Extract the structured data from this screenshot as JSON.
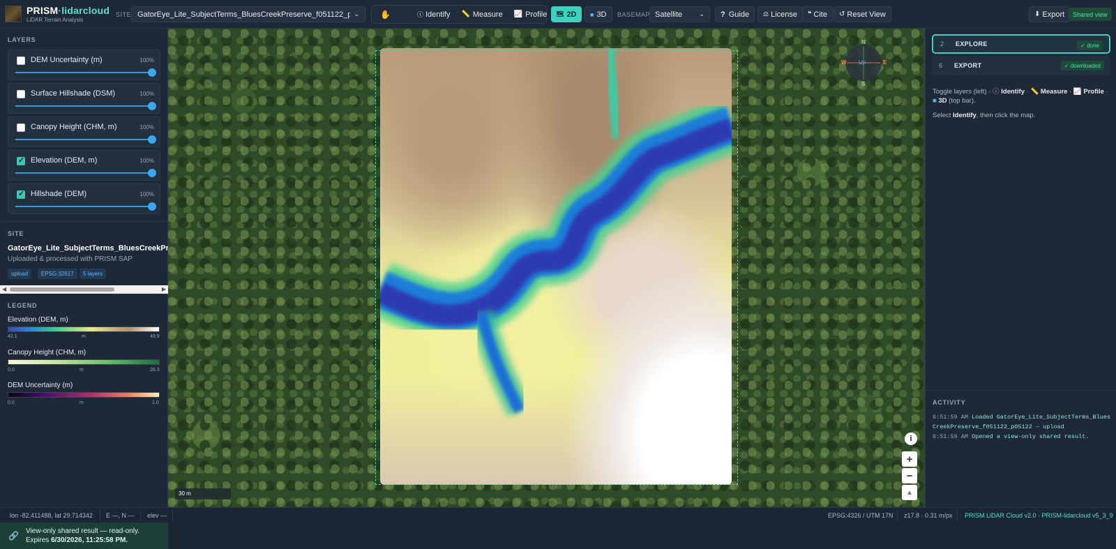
{
  "app": {
    "brand_main": "PRISM",
    "brand_accent": "·lidarcloud",
    "subtitle": "LiDAR Terrain Analysis"
  },
  "topbar": {
    "site_label": "SITE",
    "site_value": "GatorEye_Lite_SubjectTerms_BluesCreekPreserve_f051122_p05122",
    "tools": {
      "pan_icon": "hand-icon",
      "identify": "Identify",
      "measure": "Measure",
      "profile": "Profile"
    },
    "mode_2d": "2D",
    "mode_3d": "3D",
    "basemap_label": "BASEMAP",
    "basemap_value": "Satellite",
    "guide": "Guide",
    "license": "License",
    "cite": "Cite",
    "reset_view": "Reset View",
    "export": "Export",
    "shared_view": "Shared view"
  },
  "layers": {
    "title": "LAYERS",
    "items": [
      {
        "name": "DEM Uncertainty (m)",
        "opacity": "100%",
        "checked": false
      },
      {
        "name": "Surface Hillshade (DSM)",
        "opacity": "100%",
        "checked": false
      },
      {
        "name": "Canopy Height (CHM, m)",
        "opacity": "100%",
        "checked": false
      },
      {
        "name": "Elevation (DEM, m)",
        "opacity": "100%",
        "checked": true
      },
      {
        "name": "Hillshade (DEM)",
        "opacity": "100%",
        "checked": true
      }
    ]
  },
  "site": {
    "title": "SITE",
    "name": "GatorEye_Lite_SubjectTerms_BluesCreekPreserve_f051122_p05122",
    "desc": "Uploaded & processed with PRISM SAP",
    "chips": [
      "upload",
      "EPSG:32617",
      "5 layers"
    ]
  },
  "legend": {
    "title": "LEGEND",
    "items": [
      {
        "name": "Elevation (DEM, m)",
        "min": "42.1",
        "unit": "m",
        "max": "49.9"
      },
      {
        "name": "Canopy Height (CHM, m)",
        "min": "0.0",
        "unit": "m",
        "max": "26.3"
      },
      {
        "name": "DEM Uncertainty (m)",
        "min": "0.0",
        "unit": "m",
        "max": "1.0"
      }
    ]
  },
  "map": {
    "compass": {
      "n": "N",
      "s": "S",
      "e": "E",
      "w": "W",
      "up": "Up"
    },
    "scale": "30 m",
    "zoom_in": "+",
    "zoom_out": "−"
  },
  "right": {
    "steps": [
      {
        "num": "2",
        "label": "EXPLORE",
        "badge": "✓ done"
      },
      {
        "num": "6",
        "label": "EXPORT",
        "badge": "✓ downloaded"
      }
    ],
    "help1_a": "Toggle layers (left) · ",
    "help1_identify": "Identify",
    "help1_b": " · ",
    "help1_measure": "Measure",
    "help1_c": " · ",
    "help1_profile": "Profile",
    "help1_d": " · ",
    "help1_3d": "3D",
    "help1_e": " (top bar).",
    "help2_a": "Select ",
    "help2_identify": "Identify",
    "help2_b": ", then click the map.",
    "activity_title": "ACTIVITY",
    "activity": [
      {
        "time": "6:51:59 AM",
        "msg": "Loaded GatorEye_Lite_SubjectTerms_BluesCreekPreserve_f051122_p05122 — upload"
      },
      {
        "time": "6:51:59 AM",
        "msg": "Opened a view-only shared result."
      }
    ]
  },
  "status": {
    "lonlat": "lon -82.411488, lat 29.714342",
    "en": "E —, N —",
    "elev": "elev —",
    "crs": "EPSG:4326 / UTM 17N",
    "zoom": "z17.8 · 0.31 m/px",
    "version": "PRISM LiDAR Cloud v2.0 · PRISM-lidarcloud v5_3_9"
  },
  "shared_notice": {
    "line1": "View-only shared result — read-only.",
    "expires_label": "Expires ",
    "expires_value": "6/30/2026, 11:25:58 PM."
  },
  "colors": {
    "accent": "#3fd1c0",
    "success": "#56e0a6",
    "bg": "#1e2836"
  }
}
